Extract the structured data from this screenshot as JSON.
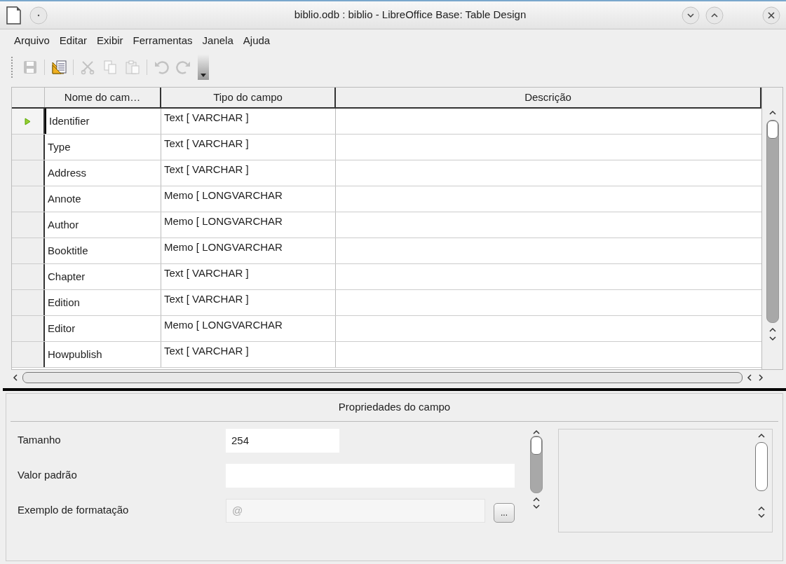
{
  "window": {
    "title": "biblio.odb : biblio - LibreOffice Base: Table Design"
  },
  "menu": [
    "Arquivo",
    "Editar",
    "Exibir",
    "Ferramentas",
    "Janela",
    "Ajuda"
  ],
  "toolbar": [
    {
      "kind": "save",
      "disabled": true
    },
    {
      "kind": "separator"
    },
    {
      "kind": "design",
      "disabled": false
    },
    {
      "kind": "separator"
    },
    {
      "kind": "cut",
      "disabled": true
    },
    {
      "kind": "copy",
      "disabled": true
    },
    {
      "kind": "paste",
      "disabled": true
    },
    {
      "kind": "separator"
    },
    {
      "kind": "undo",
      "disabled": true
    },
    {
      "kind": "redo",
      "disabled": true
    },
    {
      "kind": "more"
    }
  ],
  "table": {
    "columns": [
      "Nome do cam…",
      "Tipo do campo",
      "Descrição"
    ],
    "rows": [
      {
        "name": "Identifier",
        "type": "Text [ VARCHAR ]",
        "selected": true
      },
      {
        "name": "Type",
        "type": "Text [ VARCHAR ]",
        "selected": false
      },
      {
        "name": "Address",
        "type": "Text [ VARCHAR ]",
        "selected": false
      },
      {
        "name": "Annote",
        "type": "Memo [ LONGVARCHAR",
        "selected": false
      },
      {
        "name": "Author",
        "type": "Memo [ LONGVARCHAR",
        "selected": false
      },
      {
        "name": "Booktitle",
        "type": "Memo [ LONGVARCHAR",
        "selected": false
      },
      {
        "name": "Chapter",
        "type": "Text [ VARCHAR ]",
        "selected": false
      },
      {
        "name": "Edition",
        "type": "Text [ VARCHAR ]",
        "selected": false
      },
      {
        "name": "Editor",
        "type": "Memo [ LONGVARCHAR",
        "selected": false
      },
      {
        "name": "Howpublish",
        "type": "Text [ VARCHAR ]",
        "selected": false
      }
    ]
  },
  "properties": {
    "title": "Propriedades do campo",
    "fields": [
      {
        "label": "Tamanho",
        "value": "254",
        "kind": "short",
        "disabled": false
      },
      {
        "label": "Valor padrão",
        "kind": "wide",
        "disabled": false
      },
      {
        "label": "Exemplo de formatação",
        "value": "@",
        "kind": "button",
        "button": "...",
        "disabled": true
      }
    ]
  }
}
